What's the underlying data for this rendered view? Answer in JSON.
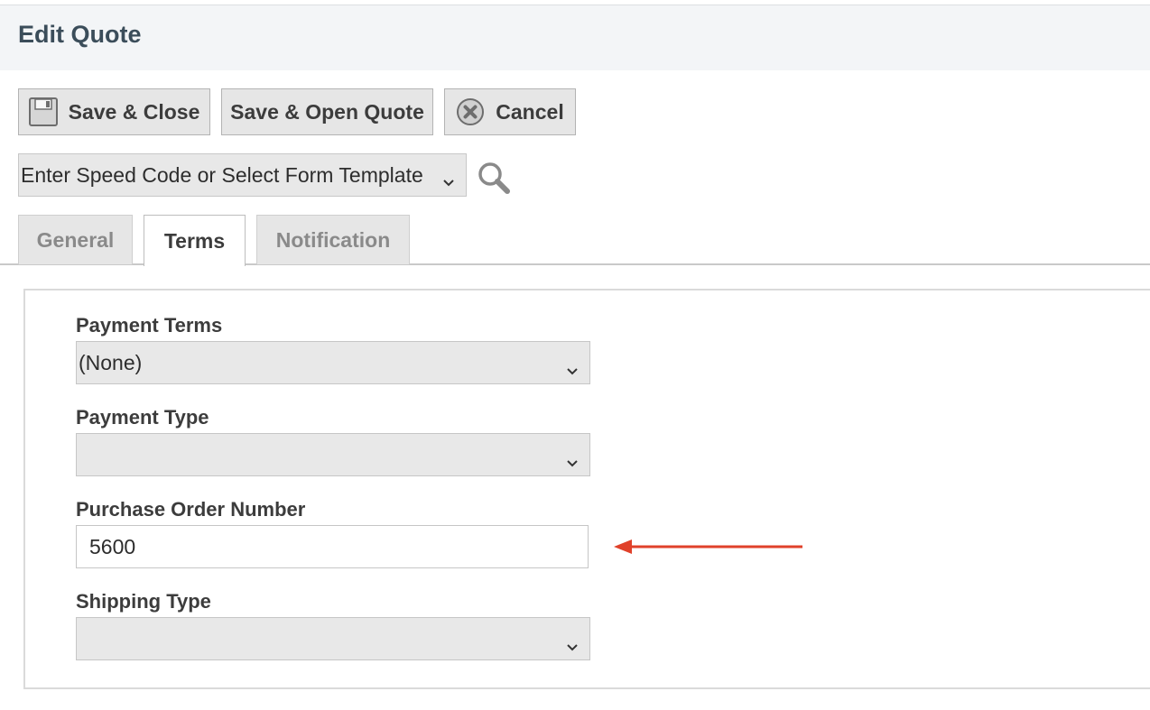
{
  "header": {
    "title": "Edit Quote"
  },
  "toolbar": {
    "save_close_label": "Save & Close",
    "save_open_label": "Save & Open Quote",
    "cancel_label": "Cancel"
  },
  "speed_code": {
    "value": "Enter Speed Code or Select Form Template"
  },
  "tabs": [
    {
      "label": "General"
    },
    {
      "label": "Terms",
      "active": true
    },
    {
      "label": "Notification"
    }
  ],
  "form": {
    "payment_terms": {
      "label": "Payment Terms",
      "value": "(None)"
    },
    "payment_type": {
      "label": "Payment Type",
      "value": ""
    },
    "po_number": {
      "label": "Purchase Order Number",
      "value": "5600"
    },
    "shipping_type": {
      "label": "Shipping Type",
      "value": ""
    }
  },
  "icons": {
    "save": "floppy-disk-icon",
    "cancel": "cancel-circle-icon",
    "search": "magnifier-icon",
    "dropdown": "chevron-down-icon"
  },
  "colors": {
    "header_bg": "#f3f5f7",
    "title": "#3b4d5a",
    "annotation_arrow": "#e0412a"
  }
}
